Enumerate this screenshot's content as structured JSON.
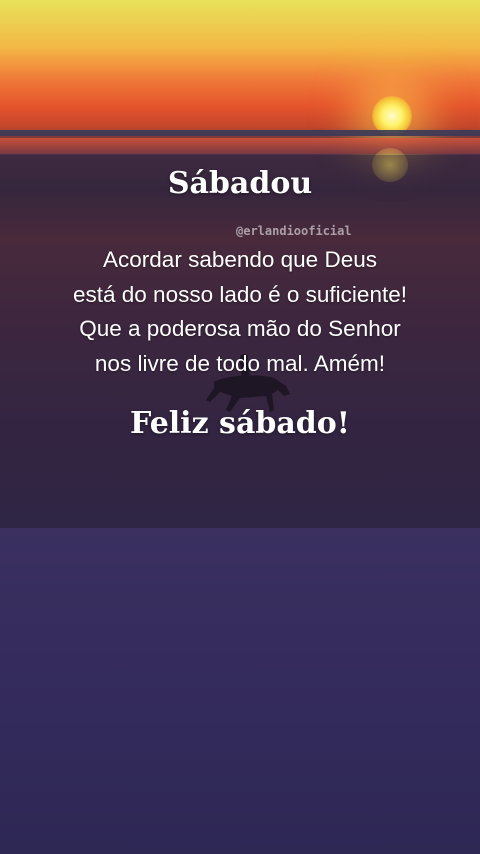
{
  "card": {
    "title": "Sábadou",
    "watermark": "@erlandiooficial",
    "message_lines": [
      "Acordar sabendo que Deus",
      "está do nosso lado é o suficiente!",
      "Que a poderosa mão do Senhor",
      "nos livre de todo mal. Amém!"
    ],
    "closing": "Feliz sábado!"
  },
  "image": {
    "subject_icon": "horse-rider-silhouette-icon",
    "sun_color": "#fff36a",
    "sky_top_color": "#e8e25a",
    "lower_background_color": "#2e2855"
  }
}
